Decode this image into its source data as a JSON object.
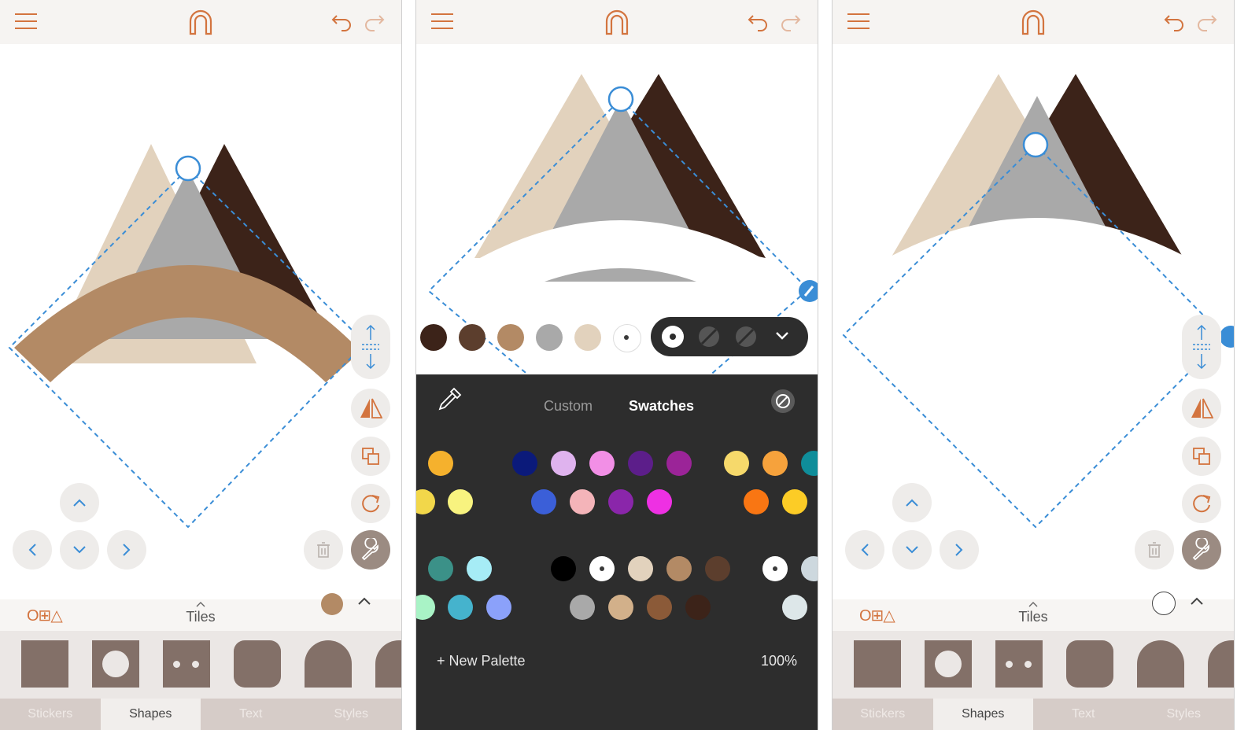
{
  "colors": {
    "accent_orange": "#d3743f",
    "selection_blue": "#3a8dd6",
    "tan": "#e2d2bd",
    "gray": "#a9a9a9",
    "dark_brown": "#3c2319",
    "band_brown": "#b38a65",
    "tile_brown": "#837068",
    "panel_dark": "#2d2d2d"
  },
  "topbar": {
    "menu_icon": "hamburger-menu-icon",
    "logo_icon": "magnet-logo-icon",
    "undo_icon": "undo-icon",
    "redo_icon": "redo-icon"
  },
  "drawer": {
    "shapes_icon_label": "O⊞△",
    "title": "Tiles",
    "tabs": [
      "Stickers",
      "Shapes",
      "Text",
      "Styles"
    ],
    "active_tab": "Shapes"
  },
  "palette_panel": {
    "tabs": [
      "Custom",
      "Swatches"
    ],
    "active_tab": "Swatches",
    "new_palette_label": "+ New Palette",
    "opacity_label": "100%",
    "eyedropper_icon": "eyedropper-icon",
    "no_color_icon": "no-color-icon",
    "top_swatches": [
      "#3c2319",
      "#5c3e2d",
      "#b38a65",
      "#a9a9a9",
      "#e2d2bd",
      "#ffffff"
    ],
    "swatch_grid": {
      "row1": [
        "#f5b12d",
        "#0b1a7a",
        "#dfb3ee",
        "#f28fe6",
        "#5c1e8a",
        "#9b2498",
        "#f6d96b",
        "#f6a23c",
        "#0f8d9a"
      ],
      "row2": [
        "#f2d74a",
        "#f8f37f",
        "#3b5fd8",
        "#f4b4b9",
        "#8a26aa",
        "#ee30e3",
        "#f97613",
        "#fccc26"
      ],
      "row3": [
        "#3b9188",
        "#a6ecf6",
        "#000000",
        "#ffffff",
        "#e2d2bd",
        "#b38a65",
        "#5c3e2d",
        "#ffffff",
        "#cdd8de"
      ],
      "row4": [
        "#a9f3c6",
        "#45b3cd",
        "#8ba1fa",
        "#a9a9a9",
        "#d2b08a",
        "#8b5a38",
        "#3c2319",
        "#dde7e9"
      ]
    }
  }
}
